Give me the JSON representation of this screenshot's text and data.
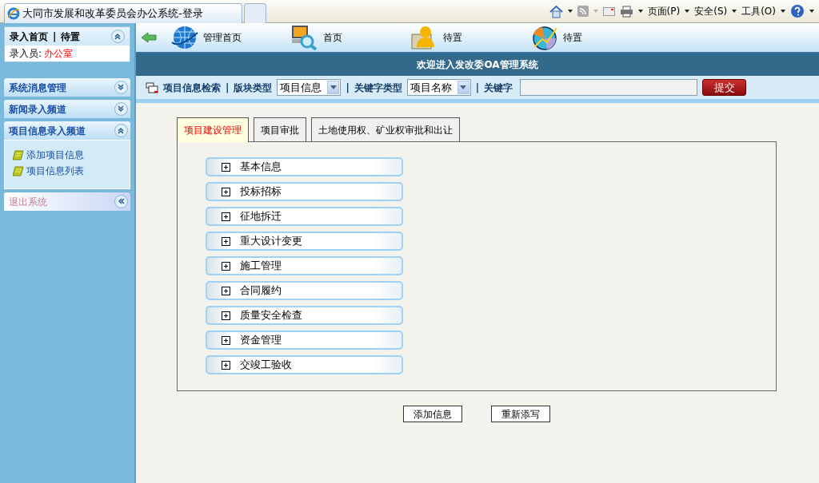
{
  "browser": {
    "tab_title": "大同市发展和改革委员会办公系统-登录",
    "menus": [
      "页面(P)",
      "安全(S)",
      "工具(O)"
    ]
  },
  "sidebar": {
    "header": {
      "title": "录入首页",
      "separator": "|",
      "link": "待置"
    },
    "user_label": "录入员:",
    "user_name": "办公室",
    "sections": [
      {
        "kind": "menu",
        "title": "系统消息管理",
        "expanded": false
      },
      {
        "kind": "menu",
        "title": "新闻录入频道",
        "expanded": false
      },
      {
        "kind": "menu",
        "title": "项目信息录入频道",
        "expanded": true,
        "items": [
          "添加项目信息",
          "项目信息列表"
        ]
      },
      {
        "kind": "exit",
        "title": "退出系统"
      }
    ]
  },
  "toolbar": [
    {
      "kind": "globe",
      "label": "管理首页"
    },
    {
      "kind": "monitor",
      "label": "首页"
    },
    {
      "kind": "person",
      "label": "待置"
    },
    {
      "kind": "chart",
      "label": "待置"
    }
  ],
  "banner": "欢迎进入发改委OA管理系统",
  "search": {
    "title": "项目信息检索",
    "sep": "|",
    "block_label": "版块类型",
    "block_value": "项目信息",
    "keytype_label": "关键字类型",
    "keytype_value": "项目名称",
    "keyword_label": "关键字",
    "submit": "提交"
  },
  "tabs": [
    {
      "label": "项目建设管理",
      "selected": true
    },
    {
      "label": "项目审批",
      "selected": false
    },
    {
      "label": "土地使用权、矿业权审批和出让",
      "selected": false
    }
  ],
  "panels": [
    {
      "label": "基本信息",
      "expanded": false
    },
    {
      "label": "投标招标",
      "expanded": false
    },
    {
      "label": "征地拆迁",
      "expanded": false
    },
    {
      "label": "重大设计变更",
      "expanded": false
    },
    {
      "label": "施工管理",
      "expanded": false
    },
    {
      "label": "合同履约",
      "expanded": false
    },
    {
      "label": "质量安全检查",
      "expanded": false
    },
    {
      "label": "资金管理",
      "expanded": false
    },
    {
      "label": "交竣工验收",
      "expanded": false
    }
  ],
  "buttons": [
    "添加信息",
    "重新添写"
  ]
}
